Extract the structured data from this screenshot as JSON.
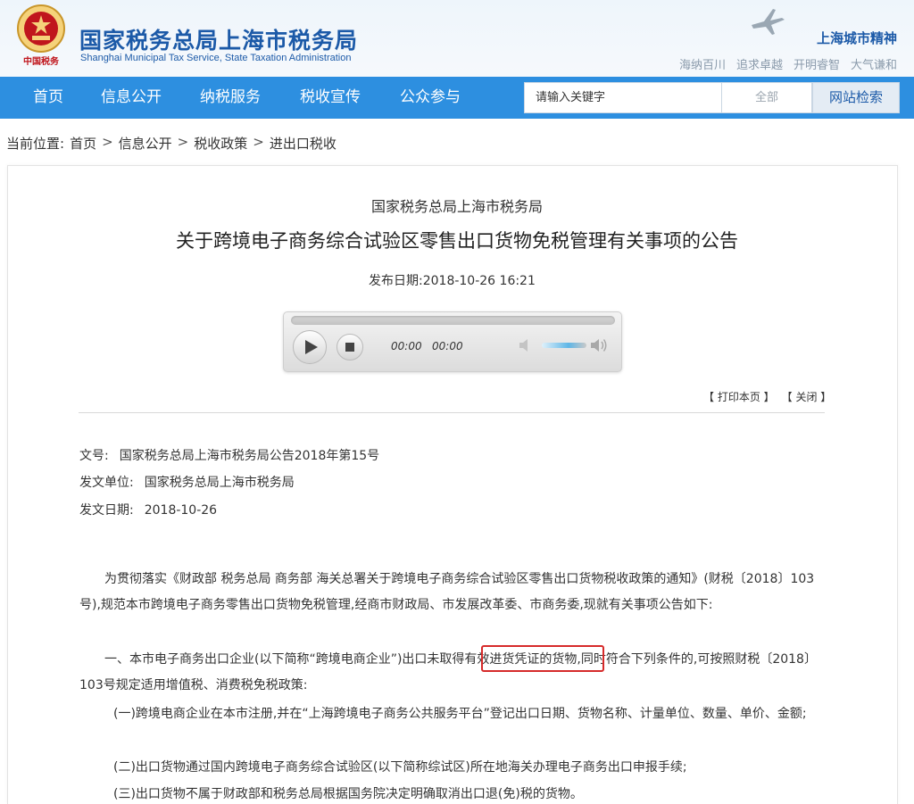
{
  "header": {
    "emblem_text": "中国税务",
    "title": "国家税务总局上海市税务局",
    "subtitle": "Shanghai Municipal Tax Service, State Taxation Administration",
    "spirit_title": "上海城市精神",
    "spirit_words": [
      "海纳百川",
      "追求卓越",
      "开明睿智",
      "大气谦和"
    ]
  },
  "nav": {
    "items": [
      "首页",
      "信息公开",
      "纳税服务",
      "税收宣传",
      "公众参与"
    ]
  },
  "search": {
    "placeholder": "请输入关键字",
    "scope": "全部",
    "button": "网站检索"
  },
  "breadcrumb": {
    "label": "当前位置:",
    "items": [
      "首页",
      "信息公开",
      "税收政策",
      "进出口税收"
    ]
  },
  "article": {
    "org": "国家税务总局上海市税务局",
    "title": "关于跨境电子商务综合试验区零售出口货物免税管理有关事项的公告",
    "publish_label": "发布日期:",
    "publish_date": "2018-10-26 16:21",
    "player": {
      "current_time": "00:00",
      "total_time": "00:00"
    },
    "print_label": "【 打印本页 】",
    "close_label": "【 关闭 】",
    "meta": [
      {
        "label": "文号:",
        "value": "国家税务总局上海市税务局公告2018年第15号"
      },
      {
        "label": "发文单位:",
        "value": "国家税务总局上海市税务局"
      },
      {
        "label": "发文日期:",
        "value": "2018-10-26"
      }
    ],
    "paragraphs": [
      "为贯彻落实《财政部 税务总局 商务部 海关总署关于跨境电子商务综合试验区零售出口货物税收政策的通知》(财税〔2018〕103号),规范本市跨境电子商务零售出口货物免税管理,经商市财政局、市发展改革委、市商务委,现就有关事项公告如下:",
      "一、本市电子商务出口企业(以下简称“跨境电商企业”)出口未取得有效进货凭证的货物,同时符合下列条件的,可按照财税〔2018〕103号规定适用增值税、消费税免税政策:",
      "(一)跨境电商企业在本市注册,并在“上海跨境电子商务公共服务平台”登记出口日期、货物名称、计量单位、数量、单价、金额;",
      "(二)出口货物通过国内跨境电子商务综合试验区(以下简称综试区)所在地海关办理电子商务出口申报手续;",
      "(三)出口货物不属于财政部和税务总局根据国务院决定明确取消出口退(免)税的货物。"
    ],
    "highlight": "未取得有效进货凭证"
  },
  "colors": {
    "brand_blue": "#1c5aa8",
    "nav_blue": "#2d8fe0",
    "highlight_red": "#d62a2a"
  }
}
